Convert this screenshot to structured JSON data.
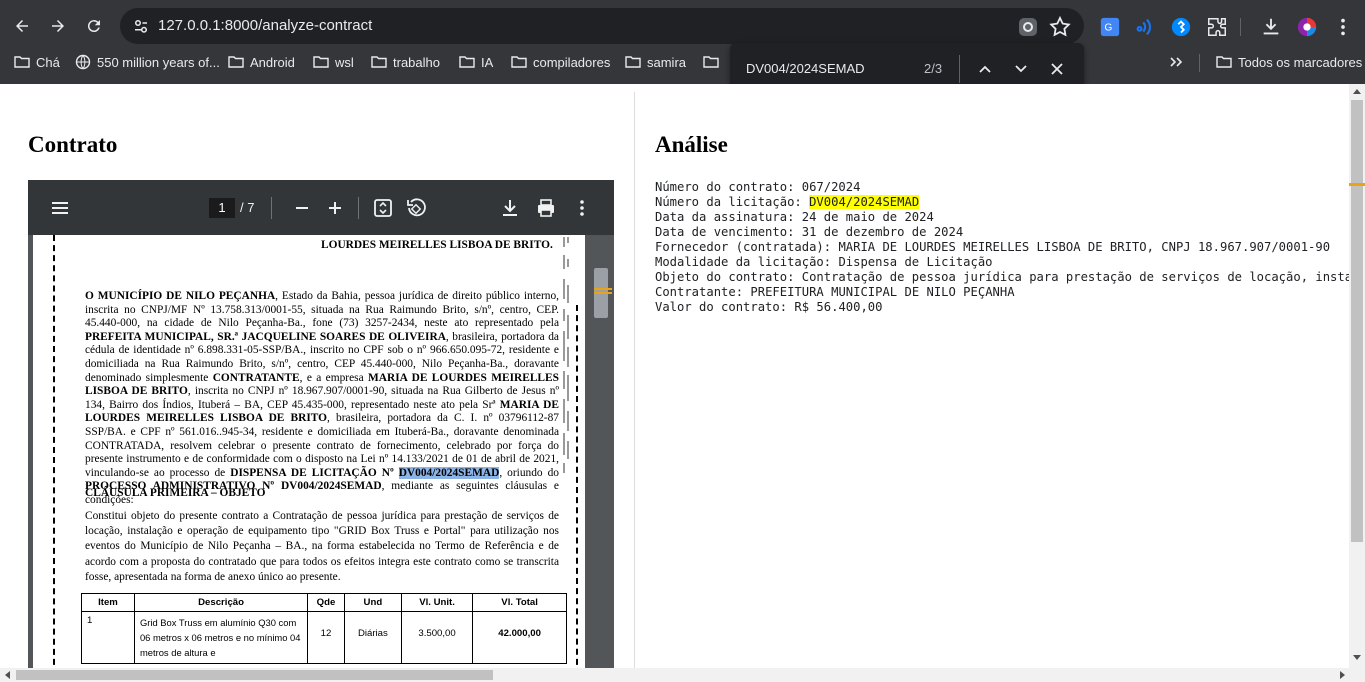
{
  "browser": {
    "url": "127.0.0.1:8000/analyze-contract",
    "bookmarks": [
      "Chá",
      "550 million years of...",
      "Android",
      "wsl",
      "trabalho",
      "IA",
      "compiladores",
      "samira"
    ],
    "all_bookmarks_label": "Todos os marcadores"
  },
  "find": {
    "query": "DV004/2024SEMAD",
    "count": "2/3"
  },
  "left": {
    "title": "Contrato"
  },
  "pdf": {
    "page_current": "1",
    "page_total": "/ 7",
    "header_line": "LOURDES MEIRELLES LISBOA DE BRITO.",
    "para1_a": "O MUNICÍPIO DE NILO PEÇANHA",
    "para1_b": ", Estado da Bahia, pessoa jurídica de direito público interno, inscrita no CNPJ/MF Nº 13.758.313/0001-55, situada na Rua Raimundo Brito, s/nº, centro, CEP. 45.440-000, na cidade de Nilo Peçanha-Ba., fone (73) 3257-2434, neste ato representado pela ",
    "para1_c": "PREFEITA MUNICIPAL, SR.ª JACQUELINE SOARES DE OLIVEIRA",
    "para1_d": ", brasileira, portadora da cédula de identidade nº 6.898.331-05-SSP/BA., inscrito no CPF sob o nº 966.650.095-72, residente e domiciliada na Rua Raimundo Brito, s/nº, centro, CEP 45.440-000, Nilo Peçanha-Ba., doravante denominado simplesmente ",
    "para1_e": "CONTRATANTE",
    "para1_f": ", e a empresa ",
    "para1_g": "MARIA DE LOURDES MEIRELLES LISBOA DE BRITO",
    "para1_h": ", inscrita no CNPJ nº 18.967.907/0001-90, situada na Rua Gilberto de Jesus nº 134, Bairro dos Índios, Ituberá – BA, CEP 45.435-000, representado neste ato pela Srª ",
    "para1_i": "MARIA DE LOURDES MEIRELLES LISBOA DE BRITO",
    "para1_j": ", brasileira, portadora da C. I. nº 03796112-87 SSP/BA. e CPF nº 561.016..945-34, residente e domiciliada em Ituberá-Ba., doravante denominada CONTRATADA, resolvem celebrar o presente contrato de fornecimento, celebrado por força do presente instrumento e de conformidade com o disposto na Lei nº 14.133/2021 de 01 de abril de 2021, vinculando-se ao processo de ",
    "para1_k": "DISPENSA DE LICITAÇÃO Nº ",
    "para1_hit": "DV004/2024SEMAD",
    "para1_l": ", oriundo do ",
    "para1_m": "PROCESSO ADMINISTRATIVO Nº DV004/2024SEMAD",
    "para1_n": ", mediante as seguintes cláusulas e condições:",
    "clause_title": "CLÁUSULA PRIMEIRA – OBJETO",
    "para2": "Constitui objeto do presente contrato a Contratação de pessoa jurídica para prestação de serviços de locação, instalação e operação de equipamento tipo \"GRID Box Truss e Portal\" para utilização nos eventos do Município de Nilo Peçanha – BA., na forma estabelecida no Termo de Referência e de acordo com a proposta do contratado que para todos os efeitos integra este contrato como se transcrita fosse, apresentada na forma de anexo único ao presente.",
    "table": {
      "headers": [
        "Item",
        "Descrição",
        "Qde",
        "Und",
        "Vl. Unit.",
        "Vl. Total"
      ],
      "row": [
        "1",
        "Grid Box Truss em alumínio Q30 com 06 metros x 06 metros e no mínimo 04 metros de altura e",
        "12",
        "Diárias",
        "3.500,00",
        "42.000,00"
      ]
    }
  },
  "right": {
    "title": "Análise",
    "lines": [
      {
        "label": "Número do contrato: ",
        "value": "067/2024"
      },
      {
        "label": "Número da licitação: ",
        "value": "DV004/2024SEMAD"
      },
      {
        "label": "Data da assinatura: ",
        "value": "24 de maio de 2024"
      },
      {
        "label": "Data de vencimento: ",
        "value": "31 de dezembro de 2024"
      },
      {
        "label": "Fornecedor (contratada): ",
        "value": "MARIA DE LOURDES MEIRELLES LISBOA DE BRITO, CNPJ 18.967.907/0001-90"
      },
      {
        "label": "Modalidade da licitação: ",
        "value": "Dispensa de Licitação"
      },
      {
        "label": "Objeto do contrato: ",
        "value": "Contratação de pessoa jurídica para prestação de serviços de locação, instala"
      },
      {
        "label": "Contratante: ",
        "value": "PREFEITURA MUNICIPAL DE NILO PEÇANHA"
      },
      {
        "label": "Valor do contrato: ",
        "value": "R$ 56.400,00"
      }
    ]
  },
  "colors": {
    "find_highlight_active": "#ffff00",
    "find_highlight_pdf": "#8cb4e6",
    "scroll_marker": "#e8a317"
  }
}
